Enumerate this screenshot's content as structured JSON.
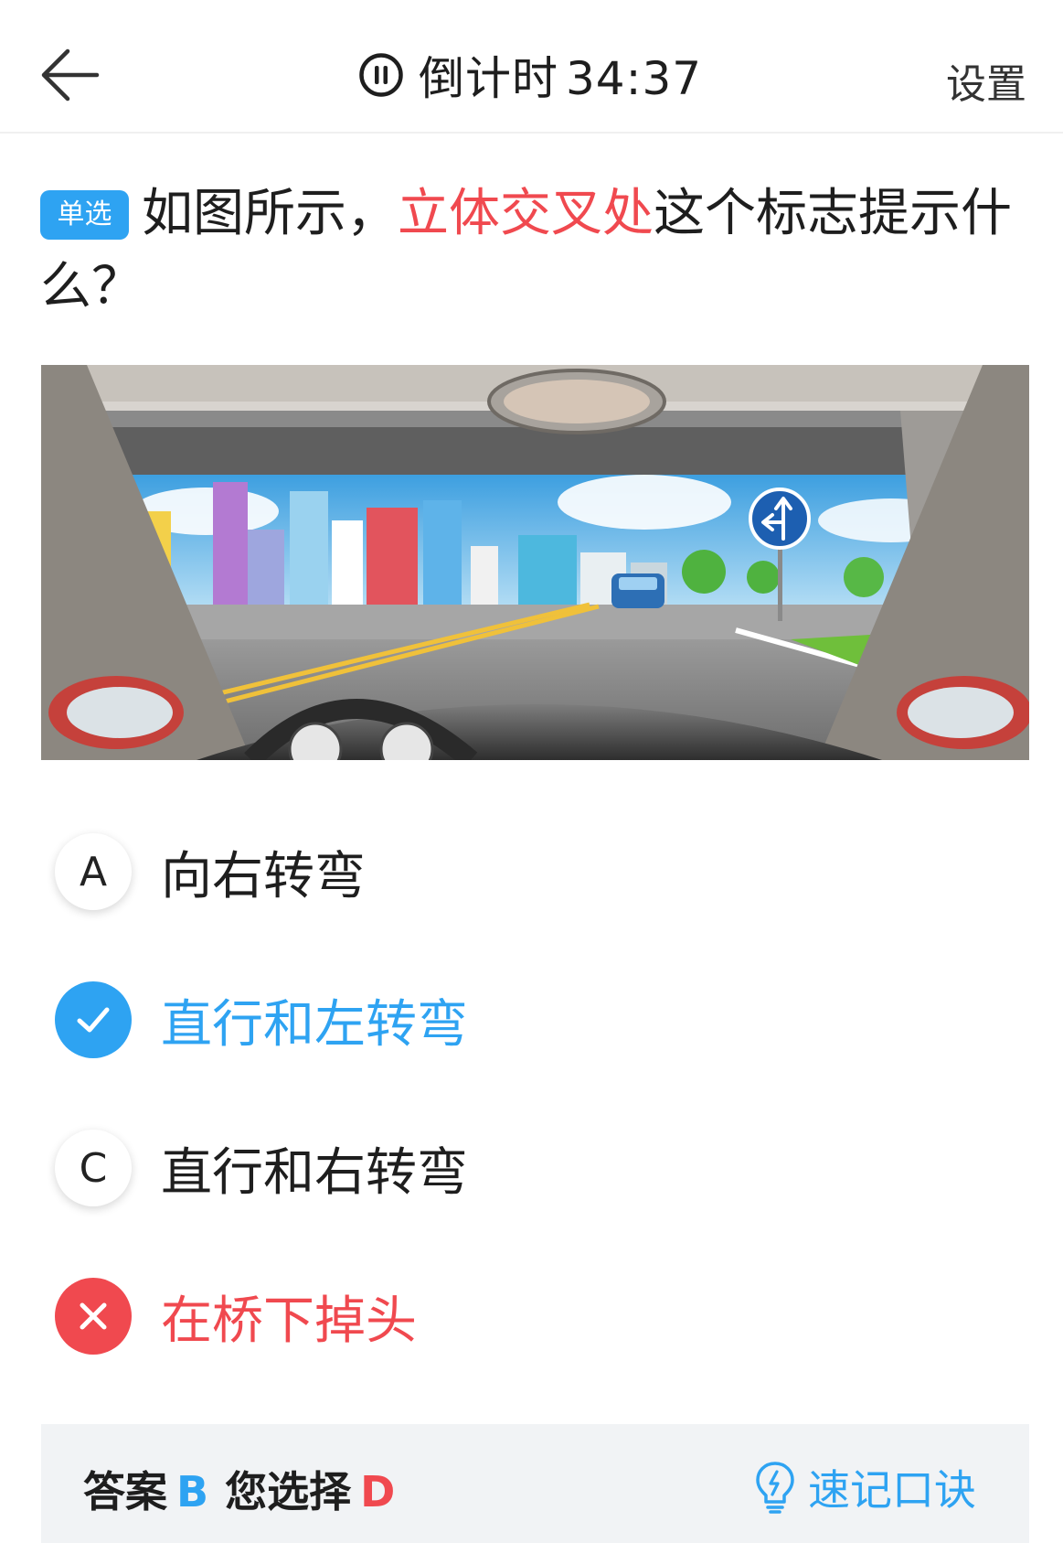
{
  "header": {
    "timer_label": "倒计时",
    "timer_value": "34:37",
    "settings_label": "设置"
  },
  "question": {
    "type_badge": "单选",
    "text_before": "如图所示，",
    "text_highlight": "立体交叉处",
    "text_after": "这个标志提示什么？"
  },
  "options": [
    {
      "letter": "A",
      "text": "向右转弯",
      "state": "normal"
    },
    {
      "letter": "B",
      "text": "直行和左转弯",
      "state": "correct"
    },
    {
      "letter": "C",
      "text": "直行和右转弯",
      "state": "normal"
    },
    {
      "letter": "D",
      "text": "在桥下掉头",
      "state": "wrong"
    }
  ],
  "answer": {
    "answer_label": "答案",
    "answer_value": "B",
    "chosen_label": "您选择",
    "chosen_value": "D",
    "tip_label": "速记口诀"
  },
  "colors": {
    "accent_blue": "#2ea3f2",
    "error_red": "#f0494f"
  },
  "icons": [
    "back-arrow-icon",
    "pause-icon",
    "check-icon",
    "cross-icon",
    "lightbulb-icon"
  ]
}
